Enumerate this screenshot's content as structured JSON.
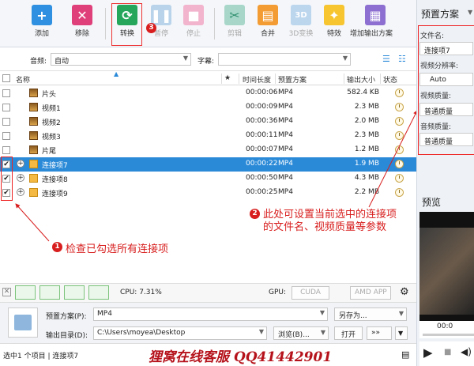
{
  "toolbar": {
    "add": "添加",
    "remove": "移除",
    "convert": "转换",
    "pause": "暂停",
    "stop": "停止",
    "cut": "剪辑",
    "merge": "合并",
    "threed": "3D变换",
    "effects": "特效",
    "add_output": "增加输出方案",
    "icon_3d": "3D"
  },
  "filter": {
    "audio_label": "音频:",
    "audio_value": "自动",
    "subtitle_label": "字幕:",
    "subtitle_value": ""
  },
  "table": {
    "headers": {
      "name": "名称",
      "star": "★",
      "duration": "时间长度",
      "preset": "预置方案",
      "size": "输出大小",
      "status": "状态"
    },
    "rows": [
      {
        "name": "片头",
        "duration": "00:00:06",
        "preset": "MP4",
        "size": "582.4 KB",
        "checked": "",
        "type": "video"
      },
      {
        "name": "视频1",
        "duration": "00:00:09",
        "preset": "MP4",
        "size": "2.3 MB",
        "checked": "",
        "type": "video"
      },
      {
        "name": "视频2",
        "duration": "00:00:36",
        "preset": "MP4",
        "size": "2.0 MB",
        "checked": "",
        "type": "video"
      },
      {
        "name": "视频3",
        "duration": "00:00:11",
        "preset": "MP4",
        "size": "2.3 MB",
        "checked": "",
        "type": "video"
      },
      {
        "name": "片尾",
        "duration": "00:00:07",
        "preset": "MP4",
        "size": "1.2 MB",
        "checked": "",
        "type": "video"
      },
      {
        "name": "连接项7",
        "duration": "00:00:22",
        "preset": "MP4",
        "size": "1.9 MB",
        "checked": "✔",
        "type": "conn"
      },
      {
        "name": "连接项8",
        "duration": "00:00:50",
        "preset": "MP4",
        "size": "4.3 MB",
        "checked": "✔",
        "type": "conn"
      },
      {
        "name": "连接项9",
        "duration": "00:00:25",
        "preset": "MP4",
        "size": "2.2 MB",
        "checked": "✔",
        "type": "conn"
      }
    ]
  },
  "cpu": {
    "label": "CPU: 7.31%",
    "gpu_label": "GPU:",
    "cuda": "CUDA",
    "amd": "AMD APP"
  },
  "output": {
    "preset_label": "预置方案(P):",
    "preset_value": "MP4",
    "save_as": "另存为...",
    "dir_label": "输出目录(D):",
    "dir_value": "C:\\Users\\moyea\\Desktop",
    "browse": "浏览(B)...",
    "open": "打开",
    "more": "»»"
  },
  "status": {
    "text": "选中1 个项目 | 连接项7",
    "watermark": "狸窝在线客服 QQ41442901"
  },
  "right_panel": {
    "title": "预置方案",
    "filename_label": "文件名:",
    "filename_value": "连接项7",
    "resolution_label": "视频分辨率:",
    "resolution_value": "Auto",
    "vquality_label": "视频质量:",
    "vquality_value": "普通质量",
    "aquality_label": "音频质量:",
    "aquality_value": "普通质量",
    "preview_label": "预览",
    "time_value": "00:0"
  },
  "annotations": {
    "n1": "1",
    "n2": "2",
    "n3": "3",
    "t1": "检查已勾选所有连接项",
    "t2a": "此处可设置当前选中的连接项",
    "t2b": "的文件名、视频质量等参数"
  },
  "colors": {
    "accent": "#2b8ad8",
    "annotation": "#d81e1e"
  }
}
